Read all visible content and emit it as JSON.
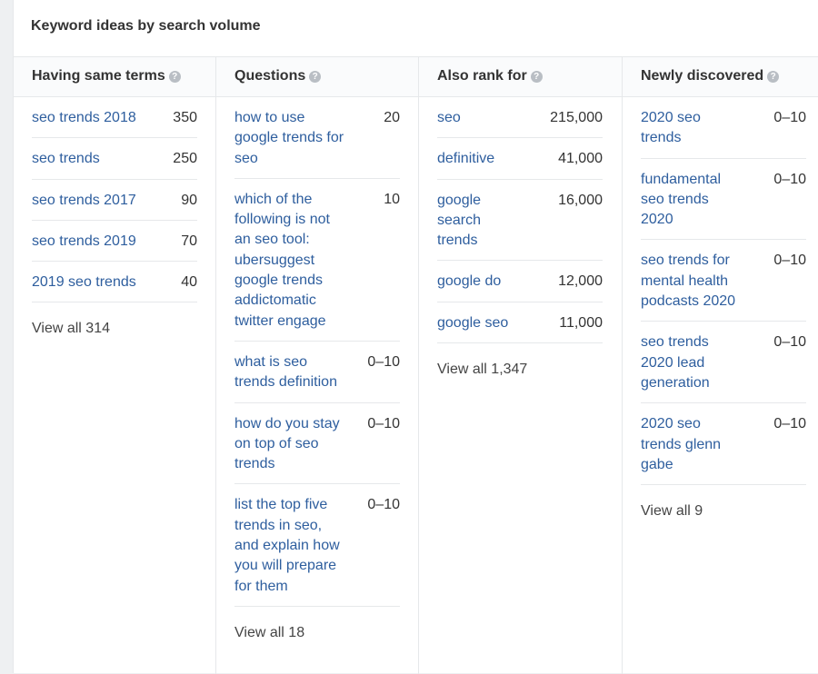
{
  "title": "Keyword ideas by search volume",
  "columns": [
    {
      "header": "Having same terms",
      "rows": [
        {
          "keyword": "seo trends 2018",
          "volume": "350"
        },
        {
          "keyword": "seo trends",
          "volume": "250"
        },
        {
          "keyword": "seo trends 2017",
          "volume": "90"
        },
        {
          "keyword": "seo trends 2019",
          "volume": "70"
        },
        {
          "keyword": "2019 seo trends",
          "volume": "40"
        }
      ],
      "view_all": "View all 314"
    },
    {
      "header": "Questions",
      "rows": [
        {
          "keyword": "how to use google trends for seo",
          "volume": "20"
        },
        {
          "keyword": "which of the following is not an seo tool: ubersuggest google trends addictomatic twitter engage",
          "volume": "10"
        },
        {
          "keyword": "what is seo trends definition",
          "volume": "0–10"
        },
        {
          "keyword": "how do you stay on top of seo trends",
          "volume": "0–10"
        },
        {
          "keyword": "list the top five trends in seo, and explain how you will prepare for them",
          "volume": "0–10"
        }
      ],
      "view_all": "View all 18"
    },
    {
      "header": "Also rank for",
      "rows": [
        {
          "keyword": "seo",
          "volume": "215,000"
        },
        {
          "keyword": "definitive",
          "volume": "41,000"
        },
        {
          "keyword": "google search trends",
          "volume": "16,000"
        },
        {
          "keyword": "google do",
          "volume": "12,000"
        },
        {
          "keyword": "google seo",
          "volume": "11,000"
        }
      ],
      "view_all": "View all 1,347"
    },
    {
      "header": "Newly discovered",
      "rows": [
        {
          "keyword": "2020 seo trends",
          "volume": "0–10"
        },
        {
          "keyword": "fundamental seo trends 2020",
          "volume": "0–10"
        },
        {
          "keyword": "seo trends for mental health podcasts 2020",
          "volume": "0–10"
        },
        {
          "keyword": "seo trends 2020 lead generation",
          "volume": "0–10"
        },
        {
          "keyword": "2020 seo trends glenn gabe",
          "volume": "0–10"
        }
      ],
      "view_all": "View all 9"
    }
  ]
}
